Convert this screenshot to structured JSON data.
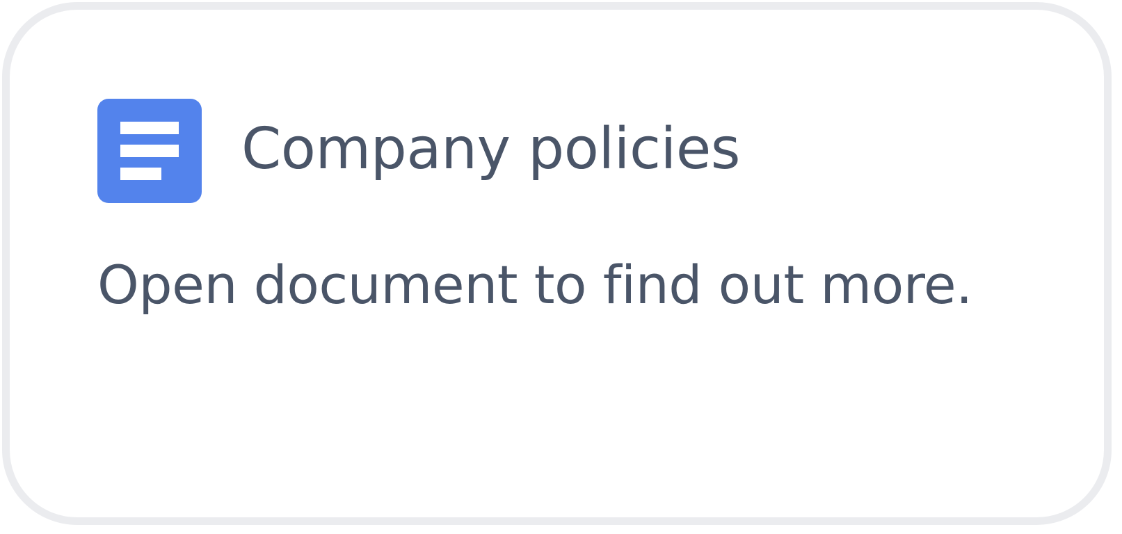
{
  "card": {
    "title": "Company policies",
    "description": "Open document to find out more.",
    "icon": "document-icon"
  },
  "colors": {
    "icon_background": "#5383ec",
    "text": "#4a5568",
    "border": "#ebecef",
    "background": "#ffffff"
  }
}
